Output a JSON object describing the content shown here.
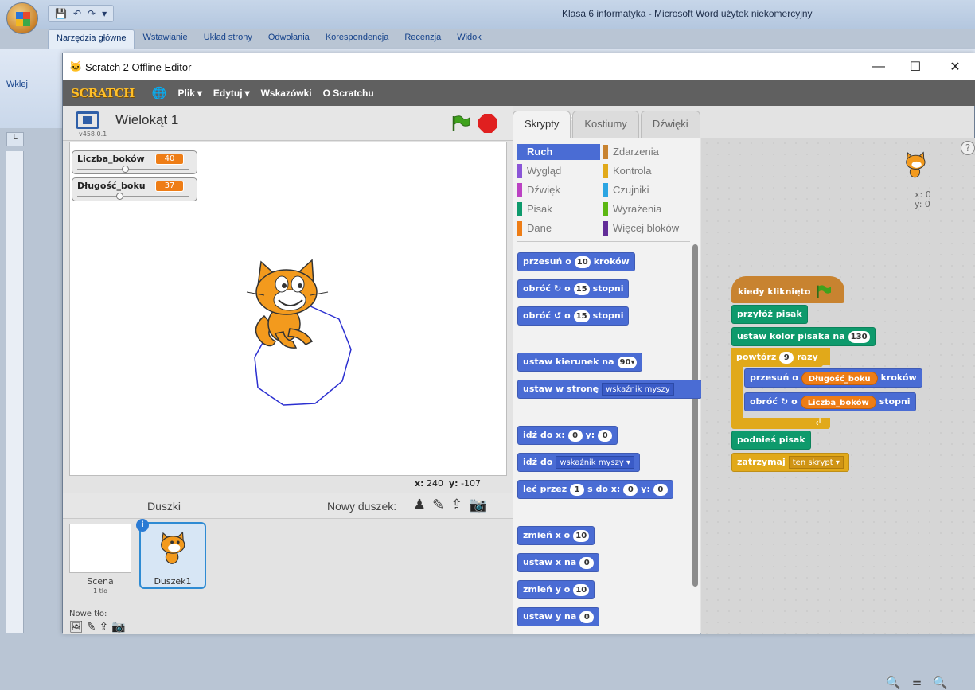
{
  "word": {
    "title": "Klasa 6 informatyka - Microsoft Word użytek niekomercyjny",
    "tabs": [
      "Narzędzia główne",
      "Wstawianie",
      "Układ strony",
      "Odwołania",
      "Korespondencja",
      "Recenzja",
      "Widok"
    ],
    "paste_label": "Wklej"
  },
  "window": {
    "title": "Scratch 2 Offline Editor",
    "minimize": "—",
    "maximize": "☐",
    "close": "✕"
  },
  "menubar": {
    "logo": "SCRATCH",
    "items": [
      {
        "label": "Plik",
        "caret": "▾"
      },
      {
        "label": "Edytuj",
        "caret": "▾"
      },
      {
        "label": "Wskazówki",
        "caret": ""
      },
      {
        "label": "O Scratchu",
        "caret": ""
      }
    ]
  },
  "stage": {
    "project_title": "Wielokąt 1",
    "version": "v458.0.1",
    "coords_x_label": "x:",
    "coords_x": "240",
    "coords_y_label": "y:",
    "coords_y": "-107",
    "monitors": [
      {
        "label": "Liczba_boków",
        "value": "40",
        "slider_fraction": 0.4
      },
      {
        "label": "Długość_boku",
        "value": "37",
        "slider_fraction": 0.35
      }
    ]
  },
  "sprites": {
    "header": "Duszki",
    "new_sprite_label": "Nowy duszek:",
    "scene_label": "Scena",
    "scene_count": "1 tło",
    "new_backdrop_label": "Nowe tło:",
    "sprite_name": "Duszek1",
    "info": "i"
  },
  "tabs": [
    "Skrypty",
    "Kostiumy",
    "Dźwięki"
  ],
  "categories": [
    {
      "label": "Ruch",
      "color": "#4a6cd4"
    },
    {
      "label": "Zdarzenia",
      "color": "#c88330"
    },
    {
      "label": "Wygląd",
      "color": "#8a55d7"
    },
    {
      "label": "Kontrola",
      "color": "#e1a91a"
    },
    {
      "label": "Dźwięk",
      "color": "#bb42c3"
    },
    {
      "label": "Czujniki",
      "color": "#2ca5e2"
    },
    {
      "label": "Pisak",
      "color": "#0e9a6c"
    },
    {
      "label": "Wyrażenia",
      "color": "#5cb712"
    },
    {
      "label": "Dane",
      "color": "#ee7d16"
    },
    {
      "label": "Więcej bloków",
      "color": "#632d99"
    }
  ],
  "palette": {
    "move": {
      "pre": "przesuń o",
      "val": "10",
      "post": "kroków"
    },
    "turn_right": {
      "pre": "obróć",
      "icon": "↻",
      "mid": "o",
      "val": "15",
      "post": "stopni"
    },
    "turn_left": {
      "pre": "obróć",
      "icon": "↺",
      "mid": "o",
      "val": "15",
      "post": "stopni"
    },
    "point_dir": {
      "pre": "ustaw kierunek na",
      "val": "90▾"
    },
    "point_towards": {
      "pre": "ustaw w stronę",
      "val": "wskaźnik myszy"
    },
    "goto_xy": {
      "pre": "idź do x:",
      "x": "0",
      "mid": "y:",
      "y": "0"
    },
    "goto": {
      "pre": "idź do",
      "val": "wskaźnik myszy ▾"
    },
    "glide": {
      "pre": "leć przez",
      "t": "1",
      "mid1": "s do x:",
      "x": "0",
      "mid2": "y:",
      "y": "0"
    },
    "change_x": {
      "pre": "zmień x o",
      "val": "10"
    },
    "set_x": {
      "pre": "ustaw x na",
      "val": "0"
    },
    "change_y": {
      "pre": "zmień y o",
      "val": "10"
    },
    "set_y": {
      "pre": "ustaw y na",
      "val": "0"
    }
  },
  "script": {
    "hat": "kiedy kliknięto",
    "pen_down": "przyłóż pisak",
    "pen_color": {
      "pre": "ustaw kolor pisaka na",
      "val": "130"
    },
    "repeat": {
      "pre": "powtórz",
      "val": "9",
      "post": "razy"
    },
    "move": {
      "pre": "przesuń o",
      "var": "Długość_boku",
      "post": "kroków"
    },
    "turn": {
      "pre": "obróć",
      "icon": "↻",
      "mid": "o",
      "var": "Liczba_boków",
      "post": "stopni"
    },
    "loop_arrow": "↲",
    "pen_up": "podnieś pisak",
    "stop": {
      "pre": "zatrzymaj",
      "val": "ten skrypt ▾"
    },
    "sprite_x": "x: 0",
    "sprite_y": "y: 0",
    "help": "?"
  },
  "zoom": {
    "out": "🔍",
    "reset": "=",
    "in": "🔍"
  }
}
